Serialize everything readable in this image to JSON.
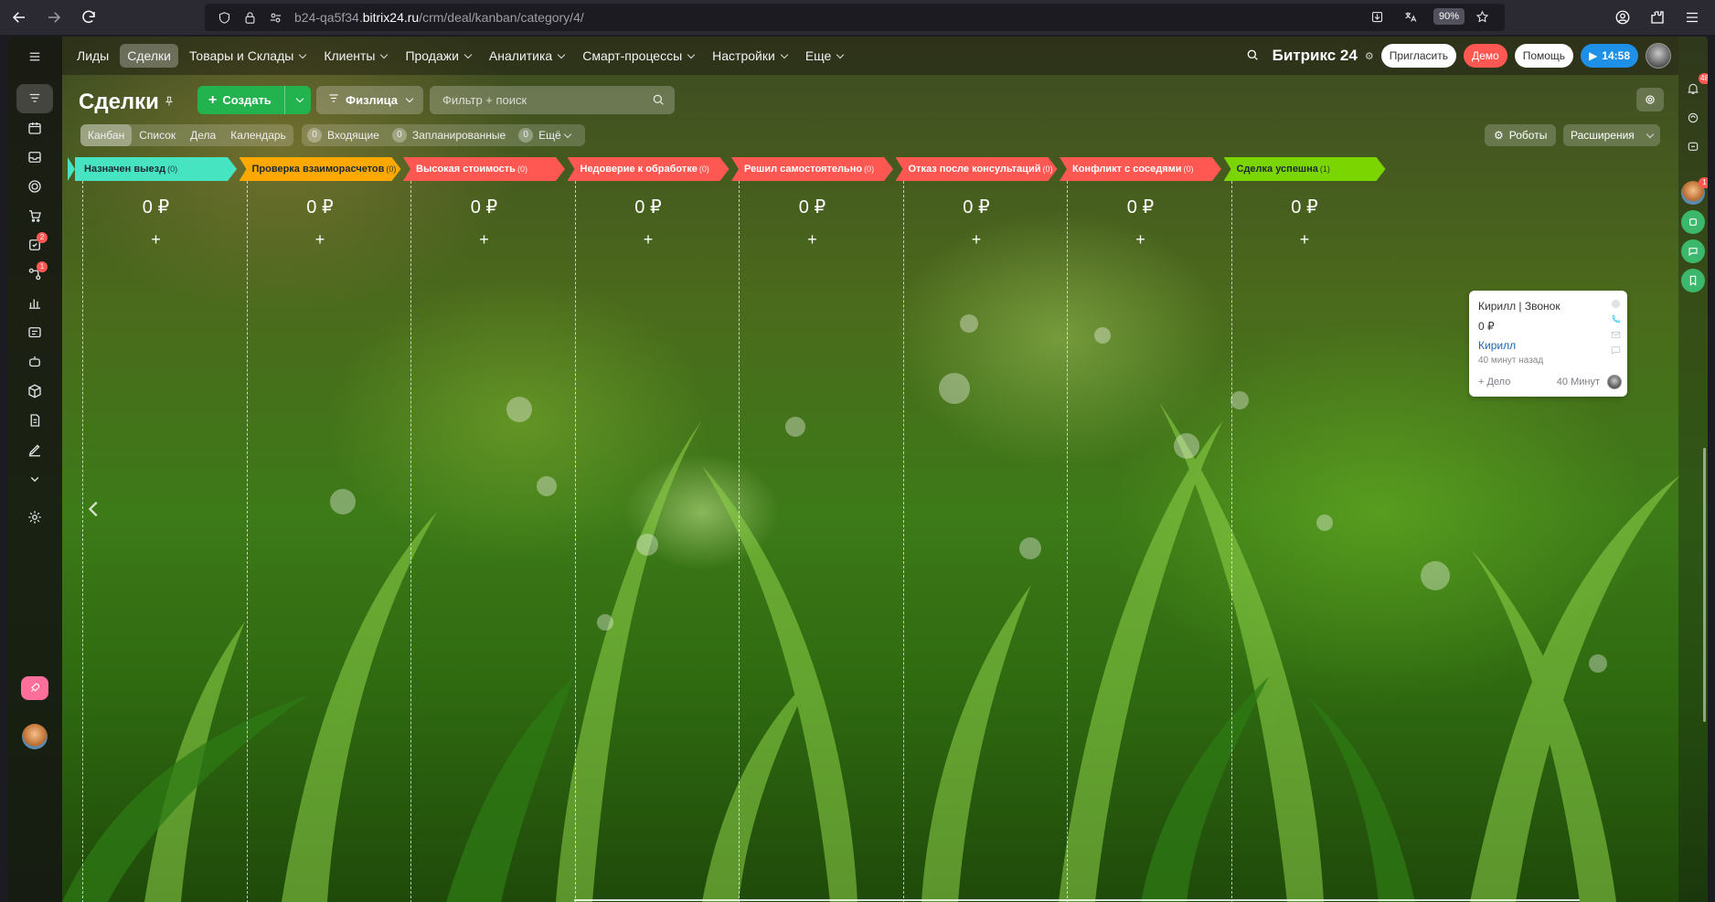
{
  "browser": {
    "url_prefix": "b24-qa5f34.",
    "url_domain": "bitrix24.ru",
    "url_path": "/crm/deal/kanban/category/4/",
    "zoom": "90%"
  },
  "topnav": {
    "items": [
      {
        "label": "Лиды",
        "chevron": false
      },
      {
        "label": "Сделки",
        "chevron": false,
        "active": true
      },
      {
        "label": "Товары и Склады",
        "chevron": true
      },
      {
        "label": "Клиенты",
        "chevron": true
      },
      {
        "label": "Продажи",
        "chevron": true
      },
      {
        "label": "Аналитика",
        "chevron": true
      },
      {
        "label": "Смарт-процессы",
        "chevron": true
      },
      {
        "label": "Настройки",
        "chevron": true
      },
      {
        "label": "Еще",
        "chevron": true
      }
    ],
    "brand": "Битрикс 24",
    "invite": "Пригласить",
    "demo": "Демо",
    "help": "Помощь",
    "time": "14:58"
  },
  "page": {
    "title": "Сделки",
    "create_label": "Создать",
    "filter_preset": "Физлица",
    "search_placeholder": "Фильтр + поиск",
    "views": [
      "Канбан",
      "Список",
      "Дела",
      "Календарь"
    ],
    "counters": [
      {
        "num": "0",
        "label": "Входящие"
      },
      {
        "num": "0",
        "label": "Запланированные"
      },
      {
        "num": "0",
        "label": "Ещё"
      }
    ],
    "robots_label": "Роботы",
    "extensions_label": "Расширения"
  },
  "kanban": {
    "stages": [
      {
        "name": "Назначен выезд",
        "count": "(0)",
        "sum": "0 ₽",
        "color": "#47e4c2",
        "text_color": "#1d2a33"
      },
      {
        "name": "Проверка взаиморасчетов",
        "count": "(0)",
        "sum": "0 ₽",
        "color": "#ffa900",
        "text_color": "#1d2a33"
      },
      {
        "name": "Высокая стоимость",
        "count": "(0)",
        "sum": "0 ₽",
        "color": "#ff5752",
        "text_color": "#ffffff"
      },
      {
        "name": "Недоверие к обработке",
        "count": "(0)",
        "sum": "0 ₽",
        "color": "#ff5752",
        "text_color": "#ffffff"
      },
      {
        "name": "Решил самостоятельно",
        "count": "(0)",
        "sum": "0 ₽",
        "color": "#ff5752",
        "text_color": "#ffffff"
      },
      {
        "name": "Отказ после консультаций",
        "count": "(0)",
        "sum": "0 ₽",
        "color": "#ff5752",
        "text_color": "#ffffff"
      },
      {
        "name": "Конфликт с соседями",
        "count": "(0)",
        "sum": "0 ₽",
        "color": "#ff5752",
        "text_color": "#ffffff"
      },
      {
        "name": "Сделка успешна",
        "count": "(1)",
        "sum": "0 ₽",
        "color": "#7bd500",
        "text_color": "#1d2a33"
      }
    ],
    "add_symbol": "+",
    "card": {
      "title": "Кирилл | Звонок",
      "sum": "0 ₽",
      "client": "Кирилл",
      "created": "40 минут назад",
      "add_activity": "+ Дело",
      "elapsed": "40 Минут"
    }
  },
  "left_rail": {
    "badges": {
      "tasks": "2",
      "flows": "1"
    }
  },
  "right_rail": {
    "notifications_badge": "48",
    "avatar_badge": "1"
  }
}
